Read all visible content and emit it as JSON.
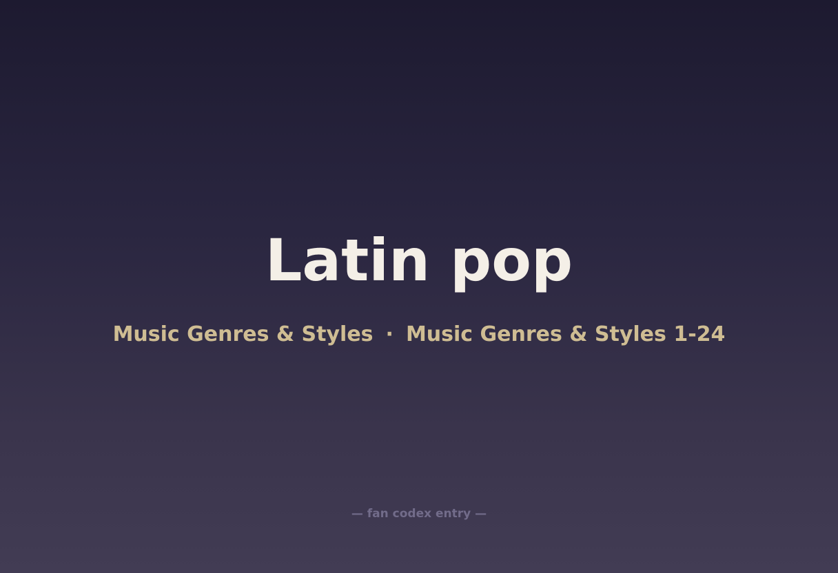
{
  "title": "Latin pop",
  "subtitle": {
    "category": "Music Genres & Styles",
    "separator": "·",
    "series": "Music Genres & Styles 1-24"
  },
  "footer": "— fan codex entry —",
  "colors": {
    "background_top": "#1d1a30",
    "background_bottom": "#423c54",
    "title": "#f4efe7",
    "subtitle": "#cfbd93",
    "footer": "#726c8a"
  }
}
